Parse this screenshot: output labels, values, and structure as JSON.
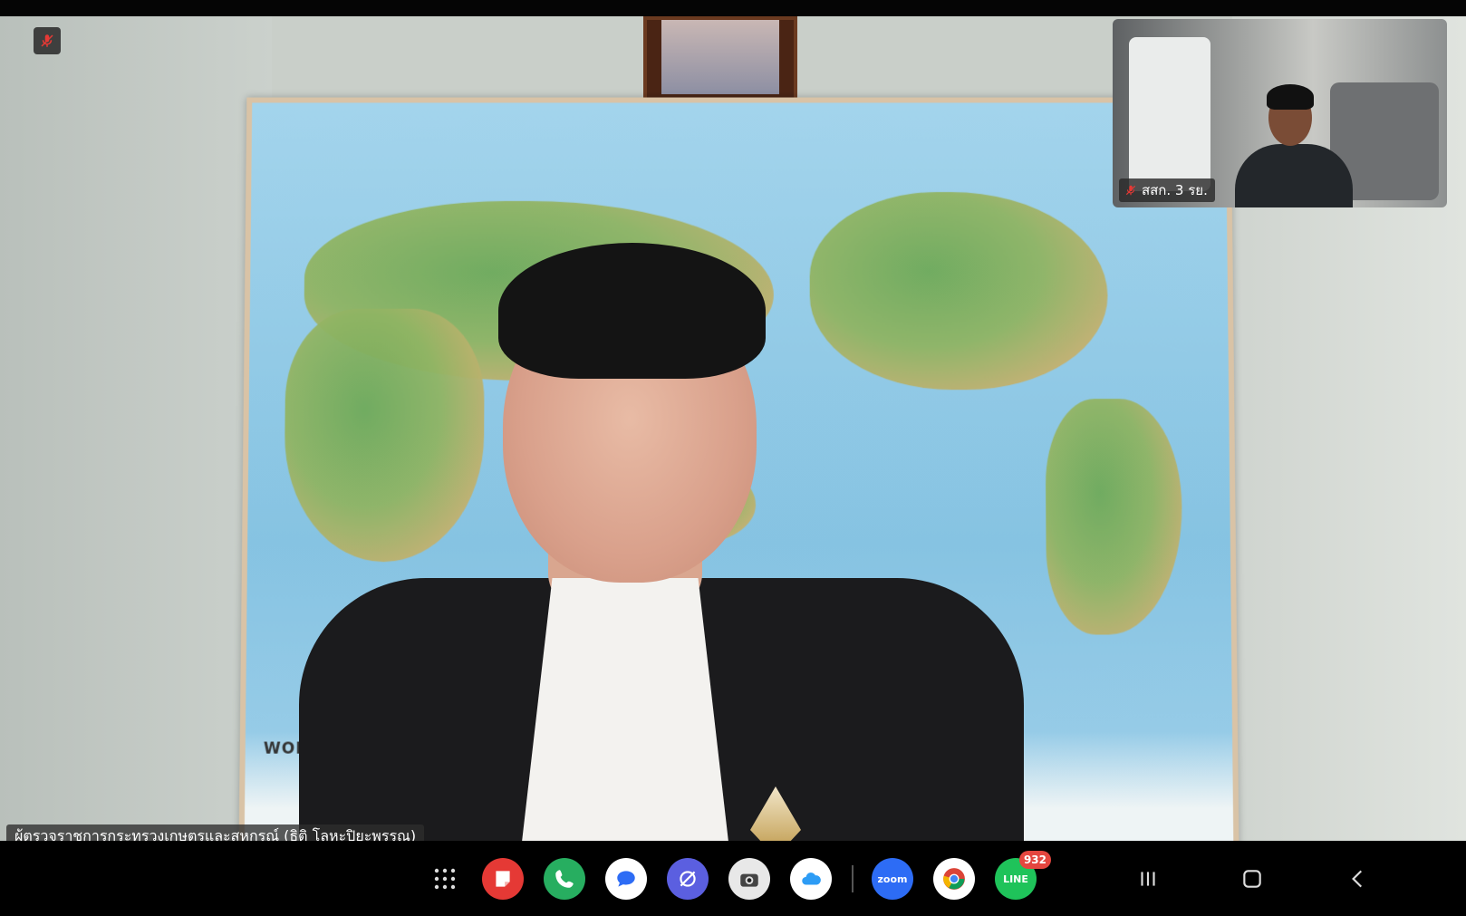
{
  "meeting": {
    "main_participant": {
      "name": "ผู้ตรวจราชการกระทรวงเกษตรและสหกรณ์ (ธิติ โลหะปิยะพรรณ)",
      "mic_status": "muted"
    },
    "map_title": "WORLD MA",
    "thumbnail": {
      "name": "สสก. 3 รย.",
      "mic_status": "muted"
    }
  },
  "taskbar": {
    "apps": [
      {
        "name": "app-drawer",
        "icon": "grid-icon"
      },
      {
        "name": "notes",
        "icon": "note-icon",
        "color": "#e53935"
      },
      {
        "name": "phone",
        "icon": "phone-icon",
        "color": "#27ae60"
      },
      {
        "name": "messages",
        "icon": "chat-icon",
        "color": "#ffffff"
      },
      {
        "name": "internet",
        "icon": "browser-icon",
        "color": "#5b5fe0"
      },
      {
        "name": "camera",
        "icon": "camera-icon",
        "color": "#e8e8e8"
      },
      {
        "name": "cloud",
        "icon": "cloud-icon",
        "color": "#ffffff"
      },
      {
        "name": "zoom",
        "label": "zoom",
        "color": "#2d6cf5"
      },
      {
        "name": "chrome",
        "icon": "chrome-icon"
      },
      {
        "name": "line",
        "label": "LINE",
        "color": "#1fc35a",
        "badge": "932"
      }
    ],
    "nav": {
      "recents": "recents-icon",
      "home": "home-icon",
      "back": "back-icon"
    }
  }
}
